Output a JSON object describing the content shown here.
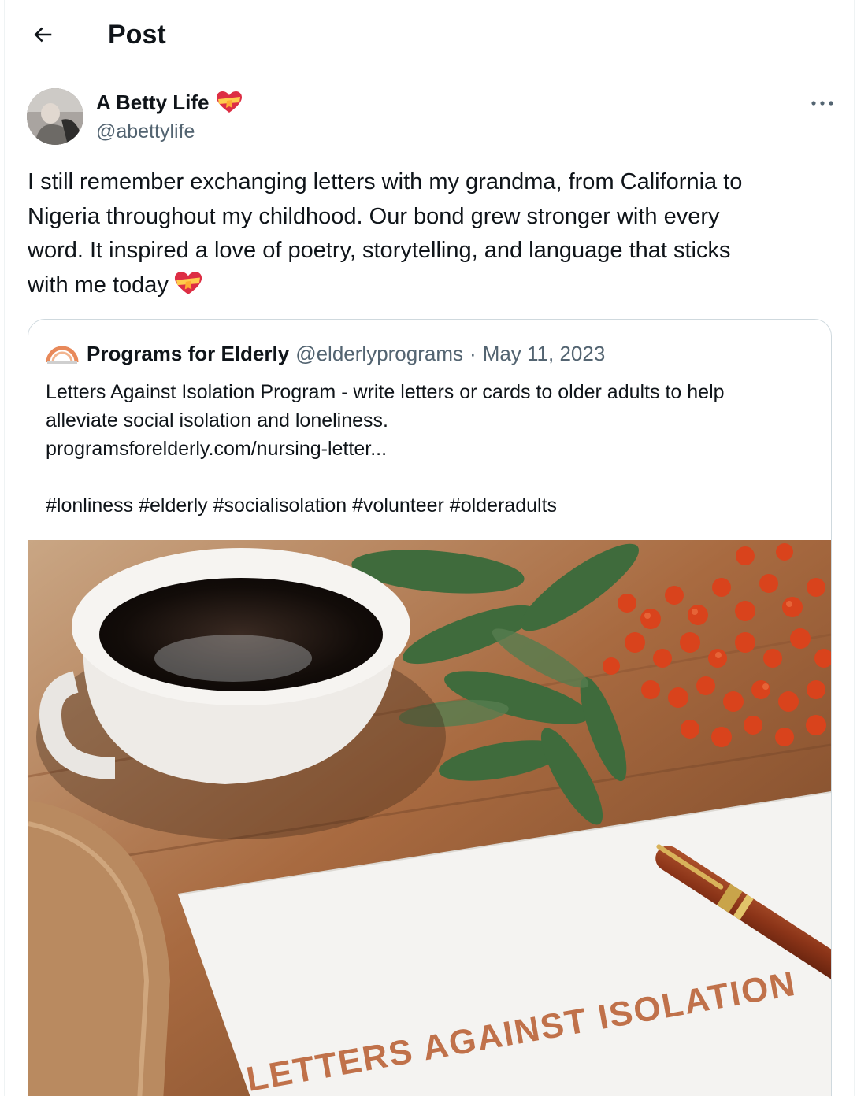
{
  "header": {
    "title": "Post"
  },
  "author": {
    "name": "A Betty Life",
    "handle": "@abettylife"
  },
  "tweet": {
    "text": "I still remember exchanging letters with my grandma, from California to\nNigeria throughout my childhood. Our bond grew stronger with every\nword. It inspired a love of poetry, storytelling, and language that sticks\nwith me today"
  },
  "quote": {
    "name": "Programs for Elderly",
    "handle": "@elderlyprograms",
    "separator": "·",
    "date": "May 11, 2023",
    "text": "Letters Against Isolation Program - write letters or cards to older adults to help\nalleviate social isolation and loneliness.\nprogramsforelderly.com/nursing-letter...\n\n#lonliness #elderly #socialisolation #volunteer #olderadults",
    "image_caption": "LETTERS AGAINST ISOLATION"
  },
  "icons": {
    "back": "arrow-left-icon",
    "more": "more-horizontal-icon",
    "heart_emoji": "heart-with-ribbon-icon"
  },
  "colors": {
    "text": "#0f1419",
    "secondary": "#536471",
    "border": "#cfd9de",
    "caption": "#c0714a"
  }
}
